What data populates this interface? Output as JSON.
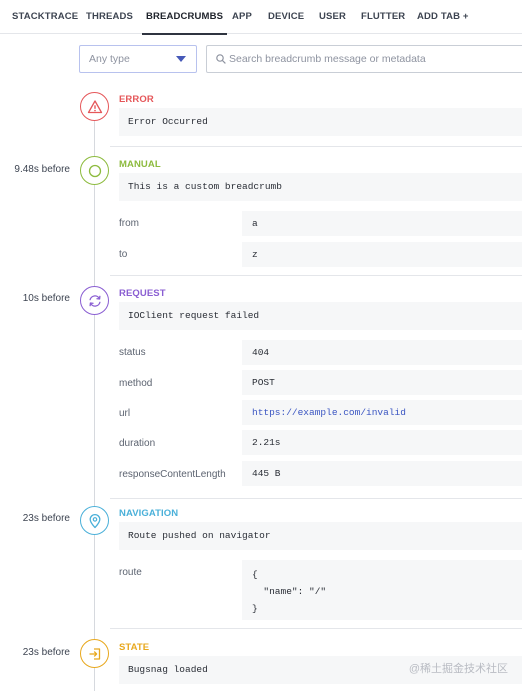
{
  "tabs": [
    {
      "label": "STACKTRACE"
    },
    {
      "label": "THREADS"
    },
    {
      "label": "BREADCRUMBS"
    },
    {
      "label": "APP"
    },
    {
      "label": "DEVICE"
    },
    {
      "label": "USER"
    },
    {
      "label": "FLUTTER"
    },
    {
      "label": "ADD TAB +"
    }
  ],
  "active_tab": "BREADCRUMBS",
  "filters": {
    "type_select": {
      "value": "Any type"
    },
    "search": {
      "placeholder": "Search breadcrumb message or metadata",
      "value": ""
    }
  },
  "breadcrumbs": [
    {
      "type": "ERROR",
      "time": "",
      "message": "Error Occurred",
      "icon": "warning-triangle-icon",
      "color": "#e5575a",
      "metadata": []
    },
    {
      "type": "MANUAL",
      "time": "9.48s before",
      "message": "This is a custom breadcrumb",
      "icon": "circle-icon",
      "color": "#8dbb3e",
      "metadata": [
        {
          "key": "from",
          "value": "a"
        },
        {
          "key": "to",
          "value": "z"
        }
      ]
    },
    {
      "type": "REQUEST",
      "time": "10s before",
      "message": "IOClient request failed",
      "icon": "refresh-icon",
      "color": "#8a5ed2",
      "metadata": [
        {
          "key": "status",
          "value": "404"
        },
        {
          "key": "method",
          "value": "POST"
        },
        {
          "key": "url",
          "value": "https://example.com/invalid"
        },
        {
          "key": "duration",
          "value": "2.21s"
        },
        {
          "key": "responseContentLength",
          "value": "445 B"
        }
      ]
    },
    {
      "type": "NAVIGATION",
      "time": "23s before",
      "message": "Route pushed on navigator",
      "icon": "location-pin-icon",
      "color": "#4ab0d9",
      "metadata": [
        {
          "key": "route",
          "value": "{\n  \"name\": \"/\"\n}"
        }
      ]
    },
    {
      "type": "STATE",
      "time": "23s before",
      "message": "Bugsnag loaded",
      "icon": "log-in-icon",
      "color": "#e8a81e",
      "metadata": []
    }
  ],
  "watermark": "@稀土掘金技术社区"
}
